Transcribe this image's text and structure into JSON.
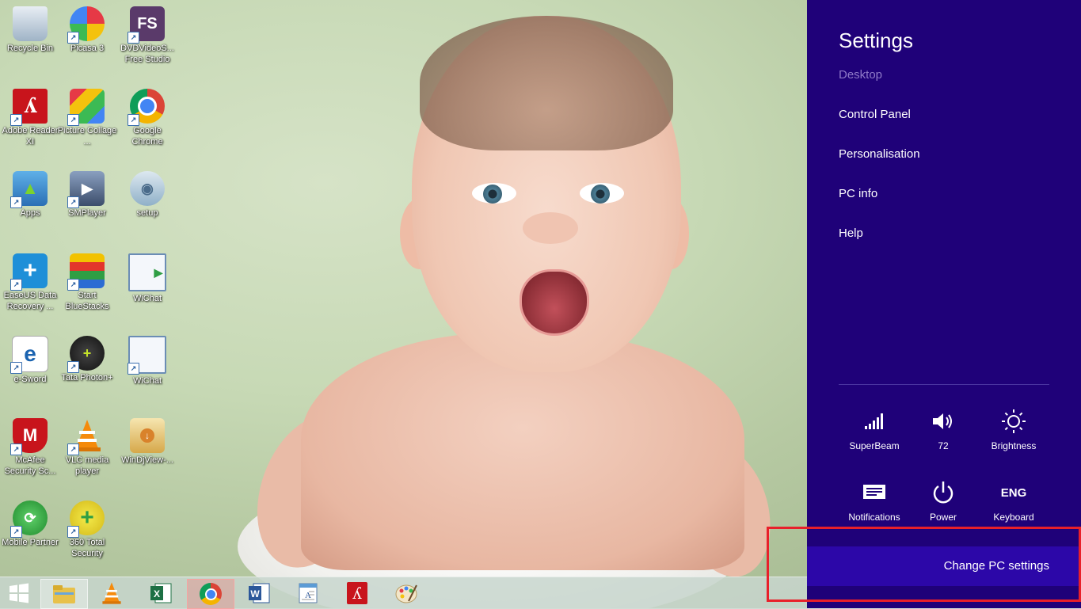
{
  "desktop_icons": [
    {
      "label": "Recycle Bin",
      "icon": "recycle-bin-icon"
    },
    {
      "label": "Picasa 3",
      "icon": "picasa-icon"
    },
    {
      "label": "DVDVideoS... Free Studio",
      "icon": "dvdvideosoft-icon",
      "glyph": "FS"
    },
    {
      "label": "Adobe Reader XI",
      "icon": "adobe-reader-icon"
    },
    {
      "label": "Picture Collage ...",
      "icon": "picture-collage-icon"
    },
    {
      "label": "Google Chrome",
      "icon": "chrome-icon"
    },
    {
      "label": "Apps",
      "icon": "apps-folder-icon"
    },
    {
      "label": "SMPlayer",
      "icon": "smplayer-icon"
    },
    {
      "label": "setup",
      "icon": "setup-icon"
    },
    {
      "label": "EaseUS Data Recovery ...",
      "icon": "easeus-icon"
    },
    {
      "label": "Start BlueStacks",
      "icon": "bluestacks-icon"
    },
    {
      "label": "WiChat",
      "icon": "wichat-icon"
    },
    {
      "label": "e-Sword",
      "icon": "esword-icon"
    },
    {
      "label": "Tata Photon+",
      "icon": "tata-photon-icon"
    },
    {
      "label": "WiChat",
      "icon": "wichat-window-icon"
    },
    {
      "label": "McAfee Security Sc...",
      "icon": "mcafee-icon"
    },
    {
      "label": "VLC media player",
      "icon": "vlc-icon"
    },
    {
      "label": "WinDjView-...",
      "icon": "windjview-icon"
    },
    {
      "label": "Mobile Partner",
      "icon": "mobile-partner-icon"
    },
    {
      "label": "360 Total Security",
      "icon": "360-security-icon"
    }
  ],
  "taskbar": {
    "items": [
      {
        "icon": "windows-start-icon"
      },
      {
        "icon": "file-explorer-icon"
      },
      {
        "icon": "vlc-icon"
      },
      {
        "icon": "excel-icon"
      },
      {
        "icon": "chrome-icon"
      },
      {
        "icon": "word-icon"
      },
      {
        "icon": "wordpad-icon"
      },
      {
        "icon": "adobe-reader-icon"
      },
      {
        "icon": "paint-icon"
      }
    ]
  },
  "settings_charm": {
    "title": "Settings",
    "context": "Desktop",
    "links": [
      "Control Panel",
      "Personalisation",
      "PC info",
      "Help"
    ],
    "quick_settings": [
      {
        "label": "SuperBeam",
        "icon": "network-signal-icon"
      },
      {
        "label": "72",
        "icon": "volume-icon"
      },
      {
        "label": "Brightness",
        "icon": "brightness-icon"
      },
      {
        "label": "Notifications",
        "icon": "notifications-icon"
      },
      {
        "label": "Power",
        "icon": "power-icon"
      },
      {
        "label": "Keyboard",
        "icon": "keyboard-icon",
        "glyph": "ENG"
      }
    ],
    "change_pc_settings": "Change PC settings",
    "accent_color": "#1f0179",
    "highlight_color": "#e8202a"
  }
}
